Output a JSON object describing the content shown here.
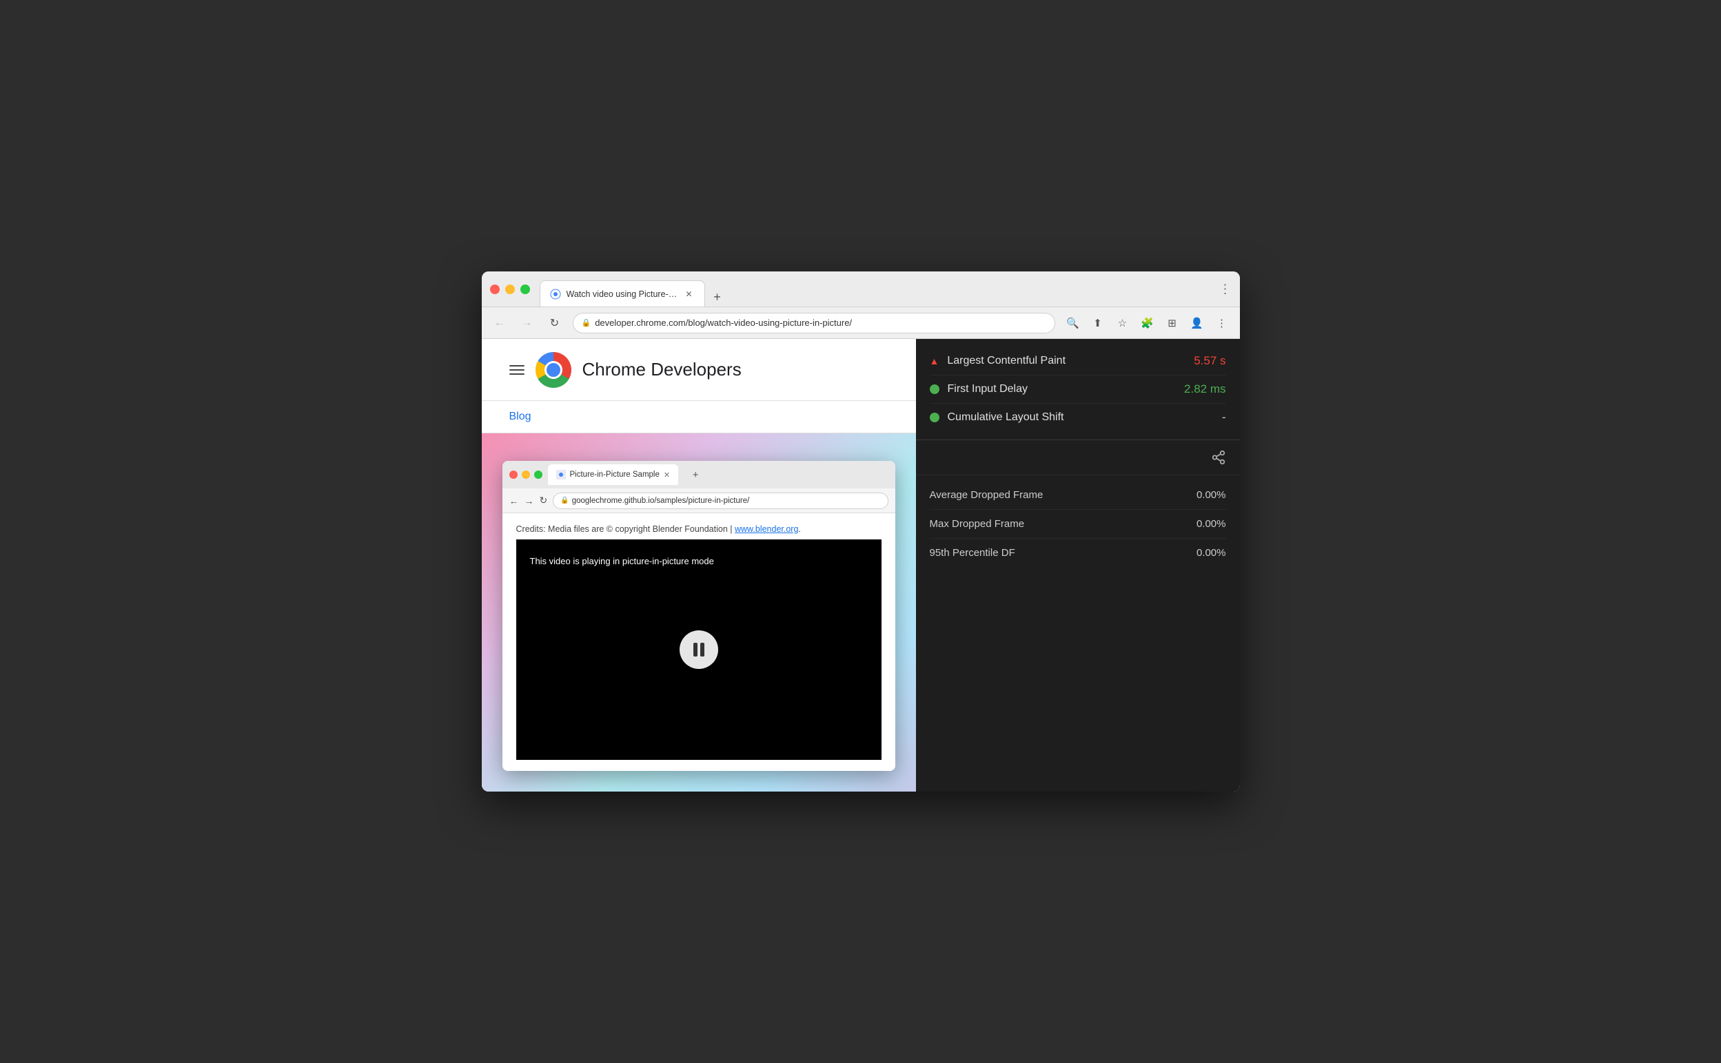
{
  "browser": {
    "title_bar": {
      "tab_title": "Watch video using Picture-in-P",
      "tab_favicon": "chrome",
      "new_tab_label": "+",
      "more_options": "⋮"
    },
    "address_bar": {
      "url": "developer.chrome.com/blog/watch-video-using-picture-in-picture/",
      "back_label": "←",
      "forward_label": "→",
      "refresh_label": "↻",
      "search_icon": "🔍",
      "share_icon": "⬆",
      "bookmark_icon": "☆",
      "extensions_icon": "🧩",
      "sidebar_icon": "⊞",
      "profile_icon": "👤",
      "more_icon": "⋮"
    }
  },
  "site": {
    "name": "Chrome Developers",
    "blog_link": "Blog"
  },
  "inner_browser": {
    "tab_title": "Picture-in-Picture Sample",
    "url": "googlechrome.github.io/samples/picture-in-picture/",
    "credits_text": "Credits: Media files are © copyright Blender Foundation |",
    "credits_link": "www.blender.org",
    "video_caption": "This video is playing in picture-in-picture mode"
  },
  "performance": {
    "metrics": [
      {
        "name": "Largest Contentful Paint",
        "value": "5.57 s",
        "value_color": "red",
        "indicator": "triangle"
      },
      {
        "name": "First Input Delay",
        "value": "2.82 ms",
        "value_color": "green",
        "indicator": "dot-green"
      },
      {
        "name": "Cumulative Layout Shift",
        "value": "-",
        "value_color": "white",
        "indicator": "dot-green"
      }
    ],
    "stats": [
      {
        "name": "Average Dropped Frame",
        "value": "0.00%"
      },
      {
        "name": "Max Dropped Frame",
        "value": "0.00%"
      },
      {
        "name": "95th Percentile DF",
        "value": "0.00%"
      }
    ]
  }
}
